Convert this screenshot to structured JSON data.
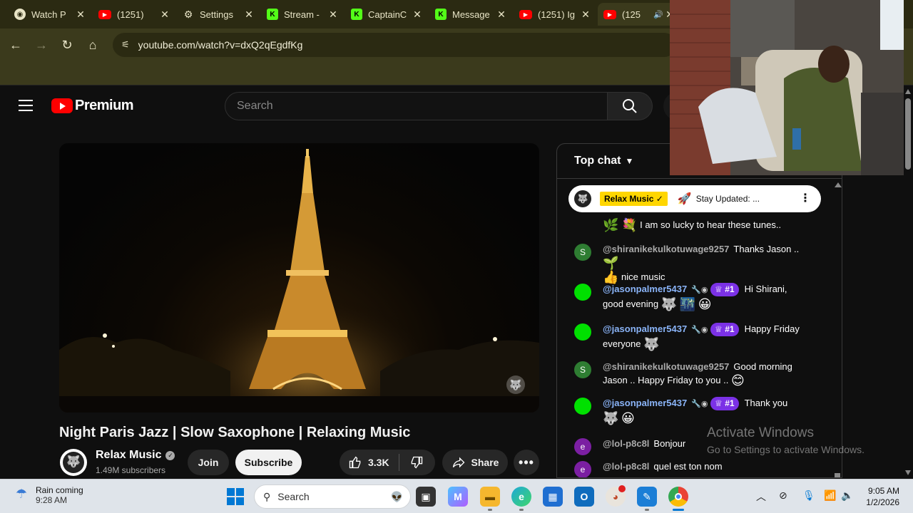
{
  "browser": {
    "tabs": [
      {
        "title": "Watch P",
        "icon": "eye-icon",
        "active": false
      },
      {
        "title": "(1251)",
        "icon": "youtube-icon",
        "active": false
      },
      {
        "title": "Settings",
        "icon": "gear-icon",
        "active": false
      },
      {
        "title": "Stream -",
        "icon": "kick-icon",
        "active": false
      },
      {
        "title": "CaptainC",
        "icon": "kick-icon",
        "active": false
      },
      {
        "title": "Message",
        "icon": "kick-icon",
        "active": false
      },
      {
        "title": "(1251) Ig",
        "icon": "youtube-icon",
        "active": false
      },
      {
        "title": "(125",
        "icon": "youtube-icon",
        "active": true
      }
    ],
    "url": "youtube.com/watch?v=dxQ2qEgdfKg"
  },
  "youtube": {
    "logo_text": "Premium",
    "search_placeholder": "Search"
  },
  "video": {
    "title": "Night Paris Jazz | Slow Saxophone | Relaxing Music",
    "channel": "Relax Music",
    "subscribers": "1.49M subscribers",
    "join_label": "Join",
    "subscribe_label": "Subscribe",
    "likes": "3.3K",
    "share_label": "Share"
  },
  "chat": {
    "header": "Top chat",
    "pinned": {
      "badge": "Relax Music",
      "message": "Stay Updated: ..."
    },
    "messages": [
      {
        "avatar": "",
        "author": "",
        "text": "I am so lucky to hear these tunes..",
        "color": "#2e7d32"
      },
      {
        "avatar": "S",
        "author": "@shiranikekulkotuwage9257",
        "text": "Thanks Jason ..",
        "text2": "nice music",
        "color": "#2e7d32"
      },
      {
        "avatar": "",
        "author": "@jasonpalmer5437",
        "rank": "#1",
        "text": "Hi Shirani,",
        "text2": "good evening",
        "color": "#00e000"
      },
      {
        "avatar": "",
        "author": "@jasonpalmer5437",
        "rank": "#1",
        "text": "Happy Friday",
        "text2": "everyone",
        "color": "#00e000"
      },
      {
        "avatar": "S",
        "author": "@shiranikekulkotuwage9257",
        "text": "Good morning",
        "text2": "Jason .. Happy Friday to you ..",
        "color": "#2e7d32"
      },
      {
        "avatar": "",
        "author": "@jasonpalmer5437",
        "rank": "#1",
        "text": "Thank you",
        "color": "#00e000"
      },
      {
        "avatar": "e",
        "author": "@lol-p8c8l",
        "text": "Bonjour",
        "color": "#7b1fa2"
      },
      {
        "avatar": "e",
        "author": "@lol-p8c8l",
        "text": "quel est ton nom",
        "color": "#7b1fa2"
      }
    ]
  },
  "watermark": {
    "line1": "Activate Windows",
    "line2": "Go to Settings to activate Windows."
  },
  "taskbar": {
    "weather_title": "Rain coming",
    "weather_time": "9:28 AM",
    "search_placeholder": "Search",
    "time": "9:05 AM",
    "date": "1/2/2026"
  }
}
